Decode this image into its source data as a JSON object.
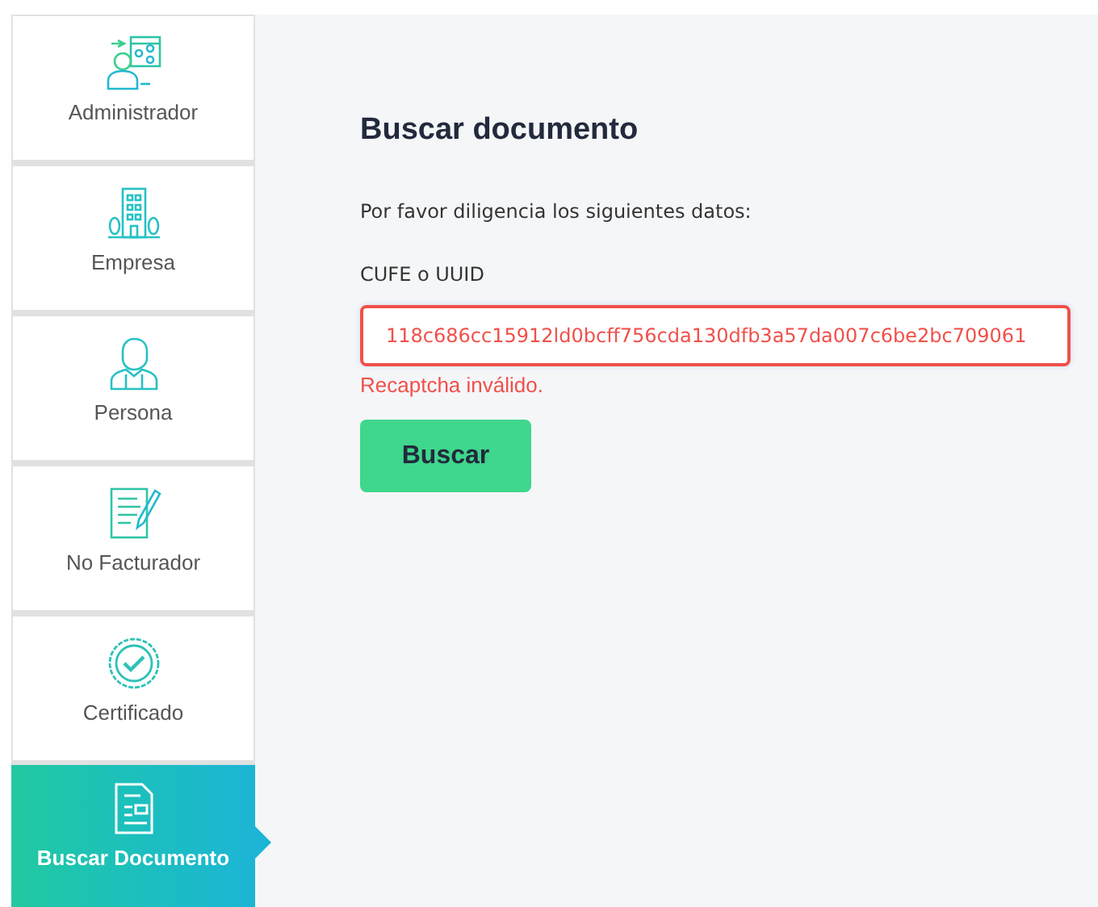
{
  "sidebar": {
    "items": [
      {
        "label": "Administrador",
        "kind": "admin",
        "selected": false
      },
      {
        "label": "Empresa",
        "kind": "company",
        "selected": false
      },
      {
        "label": "Persona",
        "kind": "person",
        "selected": false
      },
      {
        "label": "No Facturador",
        "kind": "nonbiller",
        "selected": false
      },
      {
        "label": "Certificado",
        "kind": "certificate",
        "selected": false
      },
      {
        "label": "Buscar Documento",
        "kind": "search",
        "selected": true
      }
    ]
  },
  "form": {
    "title": "Buscar documento",
    "instructions": "Por favor diligencia los siguientes datos:",
    "field_label": "CUFE o UUID",
    "field_value": "118c686cc15912ld0bcff756cda130dfb3a57da007c6be2bc709061",
    "field_invalid": true,
    "error": "Recaptcha inválido.",
    "button": "Buscar"
  }
}
